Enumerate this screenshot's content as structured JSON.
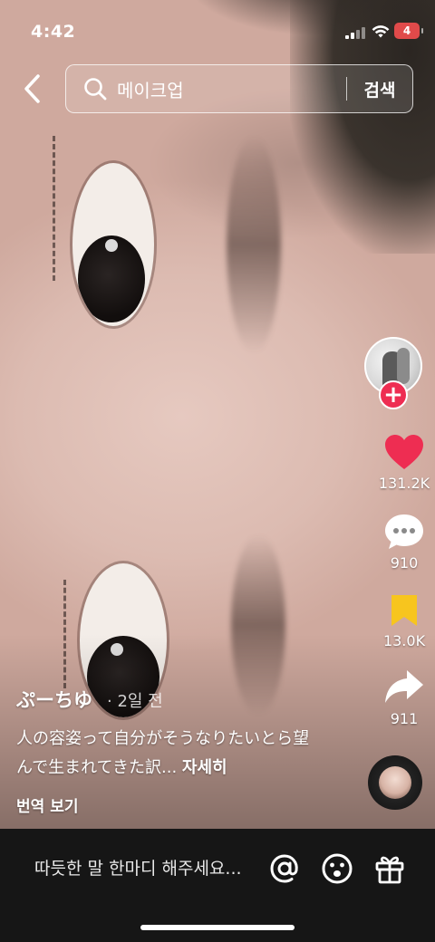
{
  "status_bar": {
    "time": "4:42",
    "battery": "4"
  },
  "search": {
    "query": "메이크업",
    "button_label": "검색"
  },
  "rail": {
    "likes": "131.2K",
    "comments": "910",
    "saves": "13.0K",
    "shares": "911",
    "follow_symbol": "+",
    "accent_color": "#ee2d52",
    "save_color": "#f7c51e"
  },
  "post": {
    "author": "ぷーちゆ",
    "date": "· 2일 전",
    "caption": "人の容姿って自分がそうなりたいとら望んで生まれてきた訳... ",
    "more_label": "자세히",
    "translate_label": "번역 보기"
  },
  "bottom_bar": {
    "comment_placeholder": "따듯한 말 한마디 해주세요..."
  },
  "icons": {
    "back": "chevron-left-icon",
    "search": "search-icon",
    "like": "heart-icon",
    "comment": "comment-bubble-icon",
    "save": "bookmark-icon",
    "share": "share-arrow-icon",
    "mention": "at-icon",
    "emoji": "emoji-icon",
    "gift": "gift-icon"
  }
}
